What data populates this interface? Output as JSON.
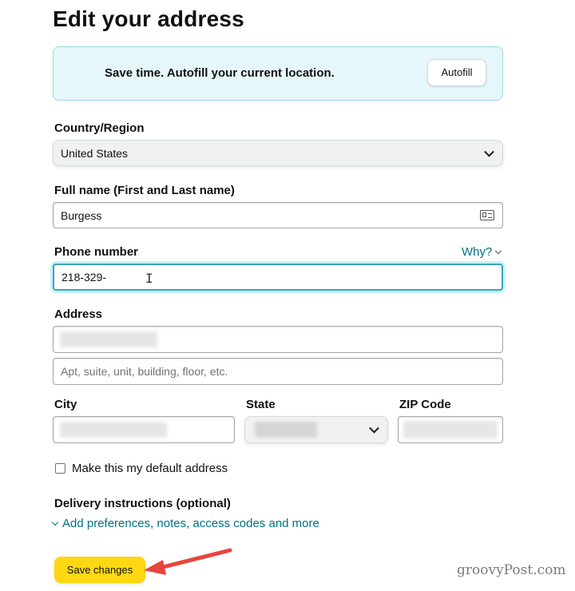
{
  "page": {
    "title": "Edit your address"
  },
  "autofill": {
    "message": "Save time. Autofill your current location.",
    "button_label": "Autofill"
  },
  "country": {
    "label": "Country/Region",
    "value": "United States"
  },
  "full_name": {
    "label": "Full name (First and Last name)",
    "value": "Burgess",
    "icon": "contact-card-icon"
  },
  "phone": {
    "label": "Phone number",
    "value": "218-329-",
    "why_link": "Why?"
  },
  "address": {
    "label": "Address",
    "line1_value": "",
    "line2_placeholder": "Apt, suite, unit, building, floor, etc."
  },
  "city": {
    "label": "City",
    "value": ""
  },
  "state": {
    "label": "State",
    "value": ""
  },
  "zip": {
    "label": "ZIP Code",
    "value": ""
  },
  "default_address": {
    "label": "Make this my default address",
    "checked": false
  },
  "delivery": {
    "label": "Delivery instructions (optional)",
    "link": "Add preferences, notes, access codes and more"
  },
  "save_button": {
    "label": "Save changes"
  },
  "annotation": {
    "arrow_color": "#e8453c"
  },
  "watermark": {
    "text": "groovyPost.com"
  },
  "colors": {
    "accent": "#ffd814",
    "link": "#007185",
    "focus": "#3ea3b5"
  }
}
